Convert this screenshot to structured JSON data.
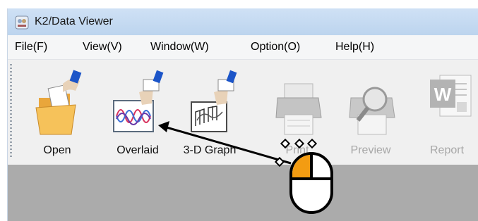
{
  "window": {
    "title": "K2/Data Viewer"
  },
  "menu": [
    "File(F)",
    "View(V)",
    "Window(W)",
    "Option(O)",
    "Help(H)"
  ],
  "toolbar": {
    "open": "Open",
    "overlaid": "Overlaid",
    "graph3d": "3-D Graph",
    "print": "Print",
    "preview": "Preview",
    "report": "Report"
  },
  "colors": {
    "accent": "#f39c12",
    "titlebar": "#c4d9f1",
    "content_bg": "#ababab"
  },
  "icons": [
    "app-icon",
    "open-folder-icon",
    "overlaid-graph-icon",
    "3d-graph-icon",
    "printer-icon",
    "print-preview-icon",
    "word-report-icon",
    "mouse-left-click-icon"
  ]
}
